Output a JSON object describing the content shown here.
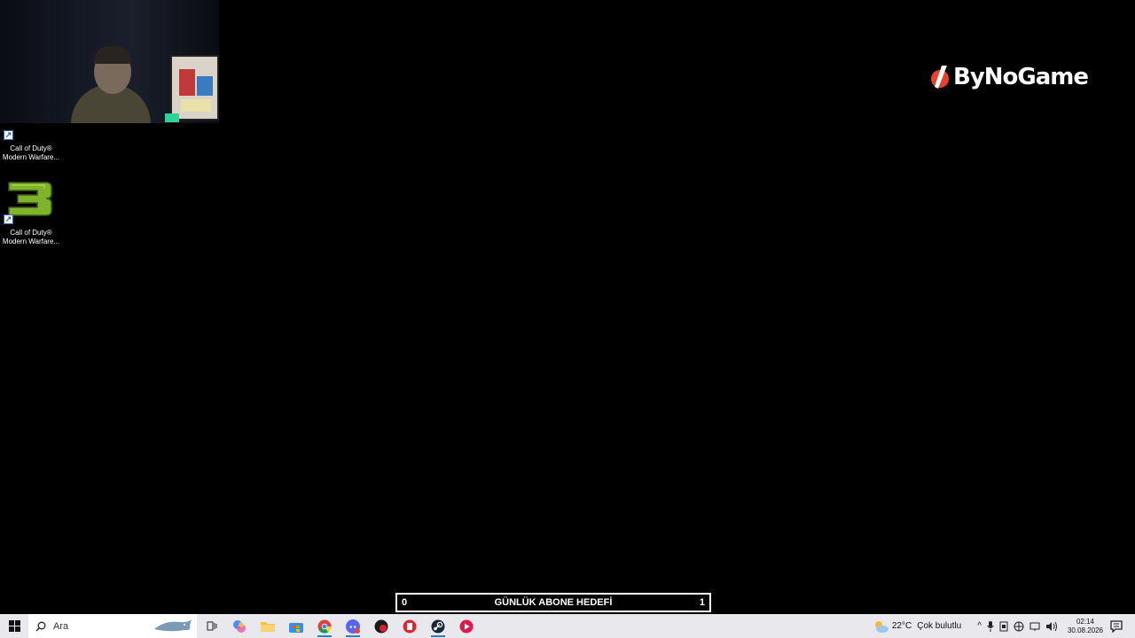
{
  "desktop_icons": [
    {
      "line1": "Call of Duty®",
      "line2": "Modern Warfare..."
    },
    {
      "line1": "Call of Duty®",
      "line2": "Modern Warfare..."
    }
  ],
  "brand": {
    "name": "ByNoGame"
  },
  "goal_bar": {
    "left": "0",
    "title": "GÜNLÜK ABONE HEDEFİ",
    "right": "1"
  },
  "taskbar": {
    "search_placeholder": "Ara",
    "weather_temp": "22°C",
    "weather_desc": "Çok bulutlu",
    "time": "02:14",
    "date": "30.08.2026"
  },
  "colors": {
    "taskbar_bg": "#e8e8ed",
    "accent": "#2b7cd3"
  }
}
